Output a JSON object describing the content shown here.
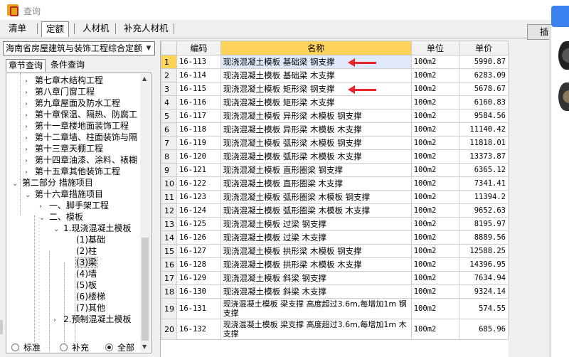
{
  "window": {
    "title": "查询"
  },
  "tabs": [
    {
      "label": "清单",
      "active": false
    },
    {
      "label": "定额",
      "active": true
    },
    {
      "label": "人材机",
      "active": false
    },
    {
      "label": "补充人材机",
      "active": false
    }
  ],
  "insert_button": {
    "label": "插"
  },
  "left": {
    "combo_value": "海南省房屋建筑与装饰工程综合定额",
    "subtabs": [
      {
        "label": "章节查询",
        "active": true
      },
      {
        "label": "条件查询",
        "active": false
      }
    ],
    "tree": [
      {
        "label": "第七章木结构工程",
        "chev": "›"
      },
      {
        "label": "第八章门窗工程",
        "chev": "›"
      },
      {
        "label": "第九章屋面及防水工程",
        "chev": "›"
      },
      {
        "label": "第十章保温、隔热、防腐工",
        "chev": "›"
      },
      {
        "label": "第十一章楼地面装饰工程",
        "chev": "›"
      },
      {
        "label": "第十二章墙、柱面装饰与隔",
        "chev": "›"
      },
      {
        "label": "第十三章天棚工程",
        "chev": "›"
      },
      {
        "label": "第十四章油漆、涂料、裱糊",
        "chev": "›"
      },
      {
        "label": "第十五章其他装饰工程",
        "chev": "›"
      },
      {
        "label": "第二部分 措施项目",
        "chev": "⌄"
      },
      {
        "label": "第十六章措施项目",
        "chev": "⌄"
      },
      {
        "label": "一、脚手架工程",
        "chev": "›"
      },
      {
        "label": "二、模板",
        "chev": "⌄"
      },
      {
        "label": "1.现浇混凝土模板",
        "chev": "⌄"
      },
      {
        "label": "(1)基础",
        "chev": ""
      },
      {
        "label": "(2)柱",
        "chev": ""
      },
      {
        "label": "(3)梁",
        "chev": "",
        "selected": true
      },
      {
        "label": "(4)墙",
        "chev": ""
      },
      {
        "label": "(5)板",
        "chev": ""
      },
      {
        "label": "(6)楼梯",
        "chev": ""
      },
      {
        "label": "(7)其他",
        "chev": ""
      },
      {
        "label": "2.预制混凝土模板",
        "chev": "›"
      }
    ],
    "radios": [
      {
        "label": "标准",
        "checked": false
      },
      {
        "label": "补充",
        "checked": false
      },
      {
        "label": "全部",
        "checked": true
      }
    ]
  },
  "table": {
    "headers": {
      "code": "编码",
      "name": "名称",
      "unit": "单位",
      "price": "单价"
    },
    "rows": [
      {
        "n": "1",
        "code": "16-113",
        "name": "现浇混凝土模板 基础梁 钢支撑",
        "unit": "100m2",
        "price": "5990.87"
      },
      {
        "n": "2",
        "code": "16-114",
        "name": "现浇混凝土模板 基础梁 木支撑",
        "unit": "100m2",
        "price": "6283.09"
      },
      {
        "n": "3",
        "code": "16-115",
        "name": "现浇混凝土模板 矩形梁 钢支撑",
        "unit": "100m2",
        "price": "5678.67"
      },
      {
        "n": "4",
        "code": "16-116",
        "name": "现浇混凝土模板 矩形梁 木支撑",
        "unit": "100m2",
        "price": "6160.83"
      },
      {
        "n": "5",
        "code": "16-117",
        "name": "现浇混凝土模板 异形梁 木模板 钢支撑",
        "unit": "100m2",
        "price": "9584.56"
      },
      {
        "n": "6",
        "code": "16-118",
        "name": "现浇混凝土模板 异形梁 木模板 木支撑",
        "unit": "100m2",
        "price": "11140.42"
      },
      {
        "n": "7",
        "code": "16-119",
        "name": "现浇混凝土模板 弧形梁 木模板 钢支撑",
        "unit": "100m2",
        "price": "11818.01"
      },
      {
        "n": "8",
        "code": "16-120",
        "name": "现浇混凝土模板 弧形梁 木模板 木支撑",
        "unit": "100m2",
        "price": "13373.87"
      },
      {
        "n": "9",
        "code": "16-121",
        "name": "现浇混凝土模板 直形圈梁 钢支撑",
        "unit": "100m2",
        "price": "6365.12"
      },
      {
        "n": "10",
        "code": "16-122",
        "name": "现浇混凝土模板 直形圈梁 木支撑",
        "unit": "100m2",
        "price": "7341.41"
      },
      {
        "n": "11",
        "code": "16-123",
        "name": "现浇混凝土模板 弧形圈梁 木模板 钢支撑",
        "unit": "100m2",
        "price": "11394.2"
      },
      {
        "n": "12",
        "code": "16-124",
        "name": "现浇混凝土模板 弧形圈梁 木模板 木支撑",
        "unit": "100m2",
        "price": "9652.63"
      },
      {
        "n": "13",
        "code": "16-125",
        "name": "现浇混凝土模板 过梁 钢支撑",
        "unit": "100m2",
        "price": "8195.97"
      },
      {
        "n": "14",
        "code": "16-126",
        "name": "现浇混凝土模板 过梁 木支撑",
        "unit": "100m2",
        "price": "8889.56"
      },
      {
        "n": "15",
        "code": "16-127",
        "name": "现浇混凝土模板 拱形梁 木模板 钢支撑",
        "unit": "100m2",
        "price": "12588.25"
      },
      {
        "n": "16",
        "code": "16-128",
        "name": "现浇混凝土模板 拱形梁 木模板 木支撑",
        "unit": "100m2",
        "price": "14396.95"
      },
      {
        "n": "17",
        "code": "16-129",
        "name": "现浇混凝土模板 斜梁 钢支撑",
        "unit": "100m2",
        "price": "7634.94"
      },
      {
        "n": "18",
        "code": "16-130",
        "name": "现浇混凝土模板 斜梁 木支撑",
        "unit": "100m2",
        "price": "9324.14"
      },
      {
        "n": "19",
        "code": "16-131",
        "name": "现浇混凝土模板 梁支撑 高度超过3.6m,每增加1m 钢支撑",
        "unit": "100m2",
        "price": "574.55"
      },
      {
        "n": "20",
        "code": "16-132",
        "name": "现浇混凝土模板 梁支撑 高度超过3.6m,每增加1m 木支撑",
        "unit": "100m2",
        "price": "685.96"
      }
    ]
  },
  "colors": {
    "header_highlight": "#ffd35a",
    "annotation_arrow": "#e8262c",
    "selection": "#dfe9fa"
  }
}
